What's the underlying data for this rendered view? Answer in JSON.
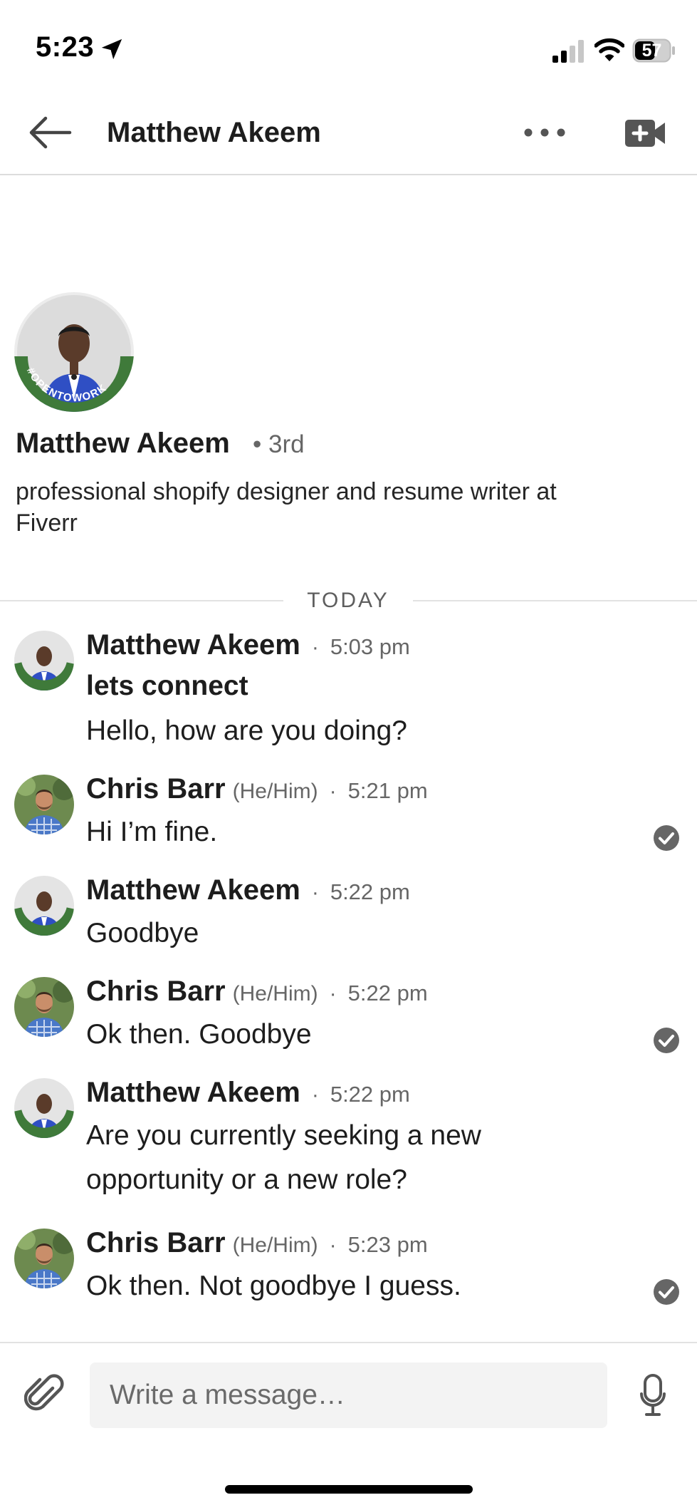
{
  "status_bar": {
    "time": "5:23",
    "battery": "57"
  },
  "header": {
    "title": "Matthew Akeem",
    "icons": [
      "back-arrow-icon",
      "more-icon",
      "video-call-icon"
    ]
  },
  "profile": {
    "name": "Matthew Akeem",
    "degree": "• 3rd",
    "headline": "professional shopify designer and resume writer at Fiverr",
    "badge_text": "#OPENTOWORK"
  },
  "day_divider": "TODAY",
  "messages": [
    {
      "sender": "Matthew Akeem",
      "pronouns": "",
      "time": "5:03 pm",
      "subject": "lets connect",
      "lines": [
        "Hello, how are you doing?"
      ],
      "read": false
    },
    {
      "sender": "Chris Barr",
      "pronouns": "(He/Him)",
      "time": "5:21 pm",
      "subject": "",
      "lines": [
        "Hi I’m fine."
      ],
      "read": true
    },
    {
      "sender": "Matthew Akeem",
      "pronouns": "",
      "time": "5:22 pm",
      "subject": "",
      "lines": [
        "Goodbye"
      ],
      "read": false
    },
    {
      "sender": "Chris Barr",
      "pronouns": "(He/Him)",
      "time": "5:22 pm",
      "subject": "",
      "lines": [
        "Ok then. Goodbye"
      ],
      "read": true
    },
    {
      "sender": "Matthew Akeem",
      "pronouns": "",
      "time": "5:22 pm",
      "subject": "",
      "lines": [
        "Are you currently seeking a new",
        "opportunity or a new role?"
      ],
      "read": false
    },
    {
      "sender": "Chris Barr",
      "pronouns": "(He/Him)",
      "time": "5:23 pm",
      "subject": "",
      "lines": [
        "Ok then. Not goodbye I guess."
      ],
      "read": true
    }
  ],
  "composer": {
    "placeholder": "Write a message…",
    "value": ""
  },
  "colors": {
    "text": "#1d1d1d",
    "muted": "#666666",
    "opentowork_green": "#3f7a3a",
    "suit_blue": "#2f4fc4",
    "check_gray": "#666666"
  }
}
